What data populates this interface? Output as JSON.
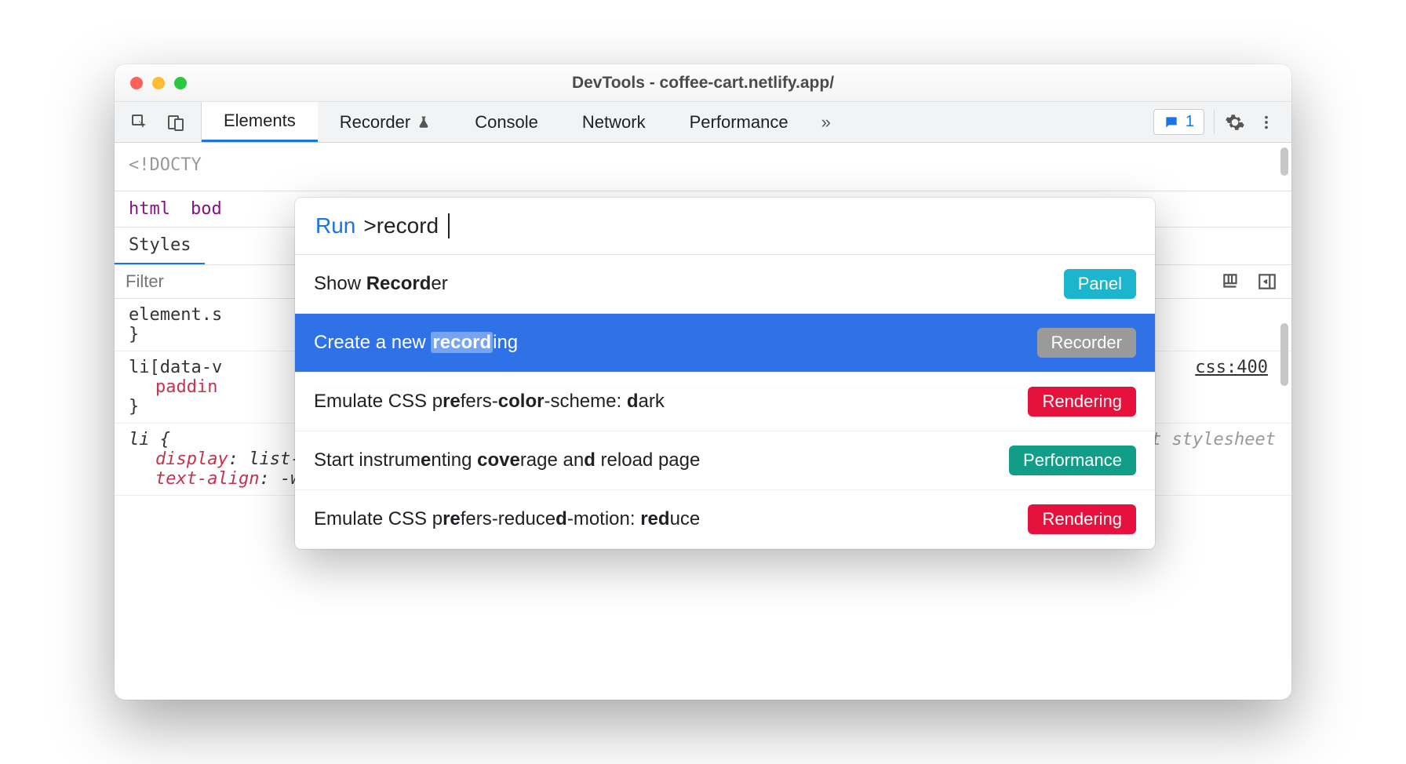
{
  "window": {
    "title": "DevTools - coffee-cart.netlify.app/"
  },
  "tabs": {
    "items": [
      "Elements",
      "Recorder",
      "Console",
      "Network",
      "Performance"
    ],
    "active_index": 0,
    "issues_count": "1"
  },
  "code": {
    "doctype": "<!DOCTY",
    "breadcrumb": [
      "html",
      "bod"
    ]
  },
  "styles": {
    "tab_label": "Styles",
    "filter_placeholder": "Filter",
    "rules": [
      {
        "selector": "element.s",
        "tail": "",
        "props": [],
        "close": "}"
      },
      {
        "selector": "li[data-v",
        "link": "css:400",
        "props": [
          {
            "name": "paddin",
            "value": ""
          }
        ],
        "close": "}"
      },
      {
        "selector": "li {",
        "note": "user agent stylesheet",
        "italic": true,
        "props": [
          {
            "name": "display",
            "value": "list-item;"
          },
          {
            "name": "text-align",
            "value": "-webkit-match-parent;"
          }
        ]
      }
    ]
  },
  "palette": {
    "prefix": "Run",
    "query": ">record",
    "items": [
      {
        "label_parts": [
          "Show ",
          "Record",
          "er"
        ],
        "badge": "Panel",
        "badge_class": "panel",
        "selected": false
      },
      {
        "label_parts": [
          "Create a new ",
          "record",
          "ing"
        ],
        "badge": "Recorder",
        "badge_class": "recorder",
        "selected": true
      },
      {
        "label_parts": [
          "Emulate CSS p",
          "re",
          "fers-",
          "color",
          "-scheme: ",
          "d",
          "ark"
        ],
        "badge": "Rendering",
        "badge_class": "rendering",
        "selected": false
      },
      {
        "label_parts": [
          "Start instrum",
          "e",
          "nting ",
          "cove",
          "rage an",
          "d",
          " reload page"
        ],
        "badge": "Performance",
        "badge_class": "performance",
        "selected": false
      },
      {
        "label_parts": [
          "Emulate CSS p",
          "re",
          "fers-reduce",
          "d",
          "-motion: ",
          "red",
          "uce"
        ],
        "badge": "Rendering",
        "badge_class": "rendering",
        "selected": false
      }
    ]
  }
}
